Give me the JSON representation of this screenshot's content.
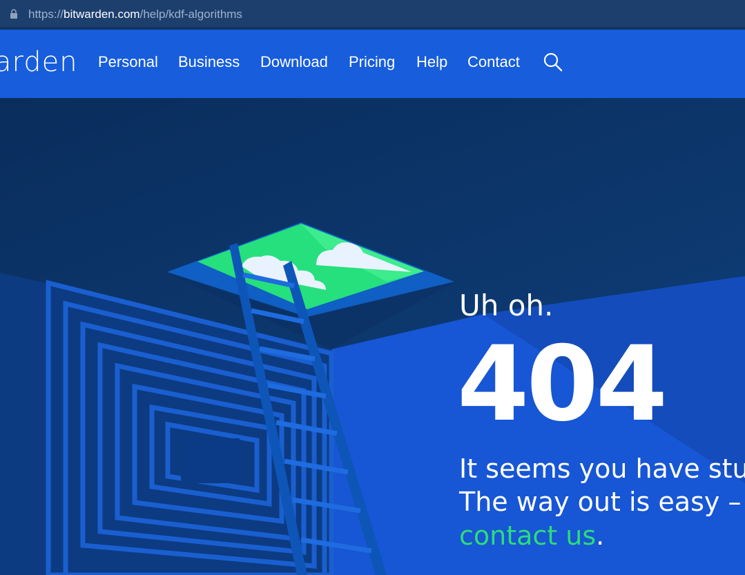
{
  "browser": {
    "url_prefix": "https://",
    "url_domain": "bitwarden.com",
    "url_path": "/help/kdf-algorithms"
  },
  "nav": {
    "logo_text": "arden",
    "links": [
      "Personal",
      "Business",
      "Download",
      "Pricing",
      "Help",
      "Contact"
    ]
  },
  "hero": {
    "heading": "Uh oh.",
    "code": "404",
    "message_line1": "It seems you have stum",
    "message_line2": "The way out is easy – r",
    "contact_link": "contact us",
    "period": "."
  },
  "colors": {
    "nav_blue": "#175ddc",
    "link_green": "#2cdc7c",
    "dark_navy": "#0a2d5c"
  }
}
